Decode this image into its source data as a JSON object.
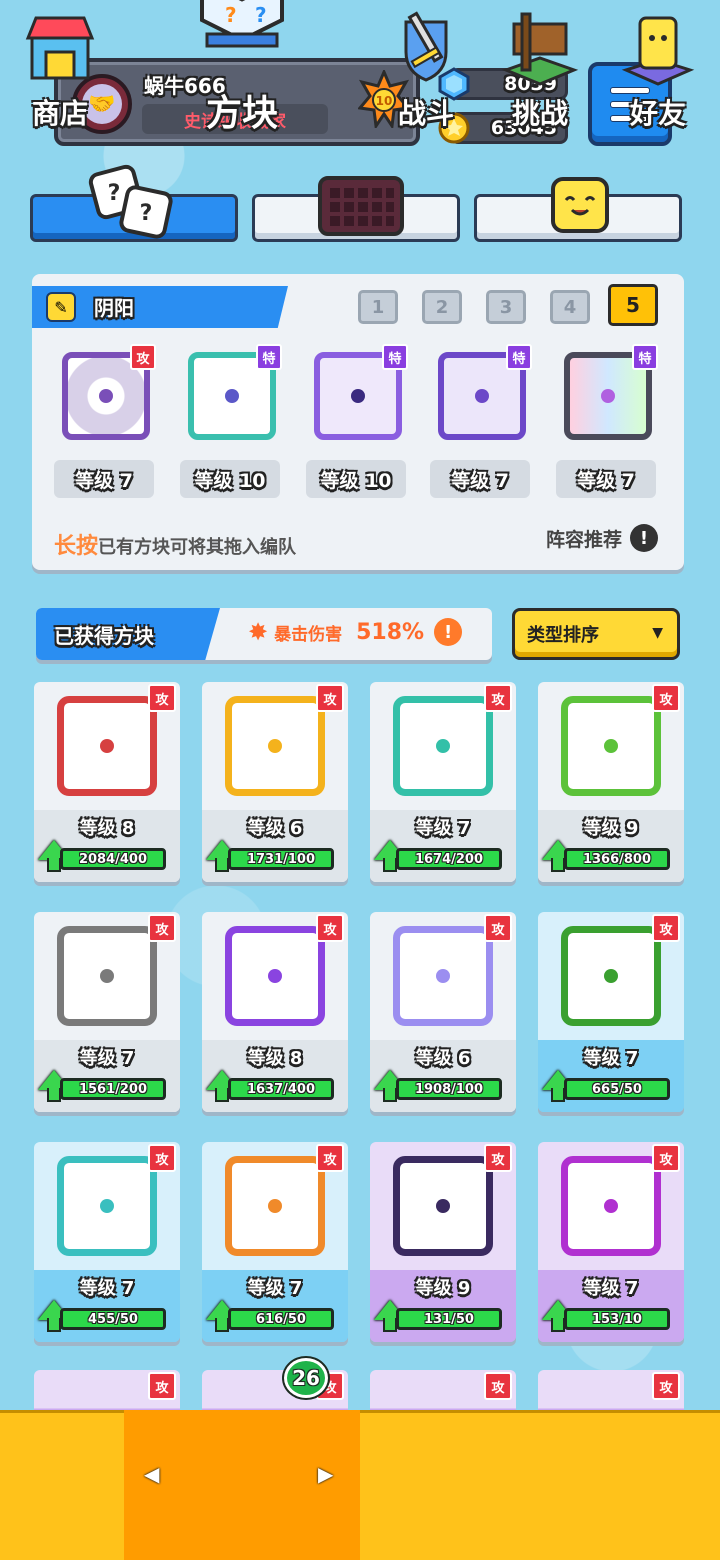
{
  "player": {
    "name": "蜗牛666",
    "title": "史诗级收藏家",
    "rank": "10"
  },
  "currency": {
    "gems": "8039",
    "coins": "63045"
  },
  "team": {
    "name": "阴阳",
    "slots": [
      "1",
      "2",
      "3",
      "4",
      "5"
    ],
    "active_slot": "5",
    "blocks": [
      {
        "tag": "攻",
        "level": "等级 7",
        "color": "#7a4fb8"
      },
      {
        "tag": "特",
        "level": "等级 10",
        "color": "#3abfae"
      },
      {
        "tag": "特",
        "level": "等级 10",
        "color": "#8a5ee0"
      },
      {
        "tag": "特",
        "level": "等级 7",
        "color": "#6c48c8"
      },
      {
        "tag": "特",
        "level": "等级 7",
        "color": "#4a4a5a"
      }
    ],
    "hint_highlight": "长按",
    "hint_rest": "已有方块可将其拖入编队",
    "recommend_label": "阵容推荐"
  },
  "owned": {
    "title": "已获得方块",
    "crit_label": "暴击伤害",
    "crit_value": "518%",
    "sort_label": "类型排序"
  },
  "cards": [
    {
      "tag": "攻",
      "level": "等级 8",
      "progress": "2084/400",
      "color": "#d64040",
      "bg": "normal"
    },
    {
      "tag": "攻",
      "level": "等级 6",
      "progress": "1731/100",
      "color": "#f4b21c",
      "bg": "normal"
    },
    {
      "tag": "攻",
      "level": "等级 7",
      "progress": "1674/200",
      "color": "#33c0a8",
      "bg": "normal"
    },
    {
      "tag": "攻",
      "level": "等级 9",
      "progress": "1366/800",
      "color": "#5cc23a",
      "bg": "normal"
    },
    {
      "tag": "攻",
      "level": "等级 7",
      "progress": "1561/200",
      "color": "#7a7a7a",
      "bg": "normal"
    },
    {
      "tag": "攻",
      "level": "等级 8",
      "progress": "1637/400",
      "color": "#8a44e0",
      "bg": "normal"
    },
    {
      "tag": "攻",
      "level": "等级 6",
      "progress": "1908/100",
      "color": "#9b8ef0",
      "bg": "normal"
    },
    {
      "tag": "攻",
      "level": "等级 7",
      "progress": "665/50",
      "color": "#3aa030",
      "bg": "blue"
    },
    {
      "tag": "攻",
      "level": "等级 7",
      "progress": "455/50",
      "color": "#3abfbf",
      "bg": "blue"
    },
    {
      "tag": "攻",
      "level": "等级 7",
      "progress": "616/50",
      "color": "#f08a2a",
      "bg": "blue"
    },
    {
      "tag": "攻",
      "level": "等级 9",
      "progress": "131/50",
      "color": "#3a2a60",
      "bg": "purple"
    },
    {
      "tag": "攻",
      "level": "等级 7",
      "progress": "153/10",
      "color": "#b030d0",
      "bg": "purple"
    }
  ],
  "bottom_nav": {
    "shop": "商店",
    "blocks": "方块",
    "battle": "战斗",
    "challenge": "挑战",
    "friends": "好友",
    "blocks_badge": "26"
  },
  "colors": {
    "background": "#8fd6ee",
    "accent_blue": "#2a8ef2",
    "accent_yellow": "#ffc21a",
    "attack_tag": "#e8333f",
    "special_tag": "#8a3ee0"
  }
}
